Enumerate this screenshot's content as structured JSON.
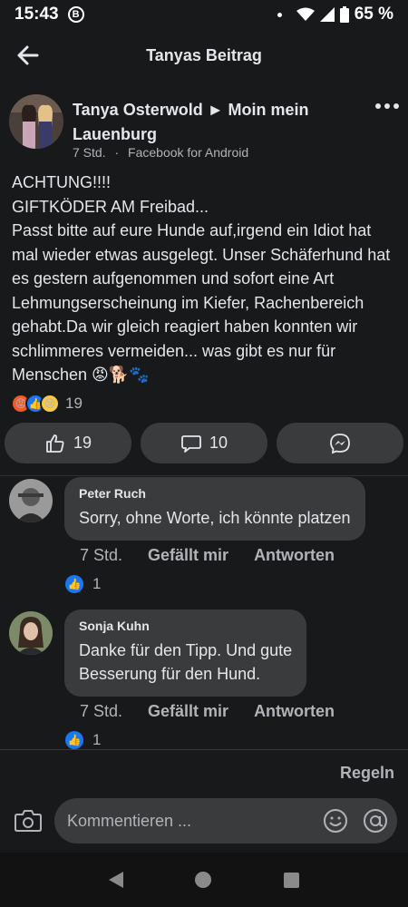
{
  "status": {
    "time": "15:43",
    "b_icon": "B",
    "battery": "65 %",
    "network": "4G"
  },
  "header": {
    "title": "Tanyas Beitrag"
  },
  "post": {
    "author": "Tanya Osterwold ► Moin mein Lauenburg",
    "meta_time": "7 Std.",
    "meta_sep": "·",
    "meta_app": "Facebook for Android",
    "text": "ACHTUNG!!!!\nGIFTKÖDER AM Freibad...\nPasst bitte auf eure Hunde auf,irgend ein Idiot hat mal wieder etwas ausgelegt. Unser Schäferhund hat es gestern aufgenommen und sofort eine Art Lehmungserscheinung im Kiefer, Rachenbereich gehabt.Da wir gleich reagiert haben konnten wir schlimmeres vermeiden... was gibt es nur für Menschen 😡🐕🐾",
    "reaction_count": "19",
    "likes": "19",
    "comments": "10"
  },
  "comments": [
    {
      "name": "Peter Ruch",
      "text": "Sorry, ohne Worte, ich könnte platzen",
      "time": "7 Std.",
      "like_label": "Gefällt mir",
      "reply_label": "Antworten",
      "reactions": "1"
    },
    {
      "name": "Sonja Kuhn",
      "text": "Danke für den Tipp. Und gute\nBesserung für den Hund.",
      "time": "7 Std.",
      "like_label": "Gefällt mir",
      "reply_label": "Antworten",
      "reactions": "1"
    }
  ],
  "footer": {
    "rules": "Regeln",
    "composer_placeholder": "Kommentieren ..."
  },
  "colors": {
    "background": "#18191a",
    "surface": "#3a3b3c",
    "text": "#e4e6eb",
    "muted": "#b0b3b8",
    "like_blue": "#1877f2"
  }
}
